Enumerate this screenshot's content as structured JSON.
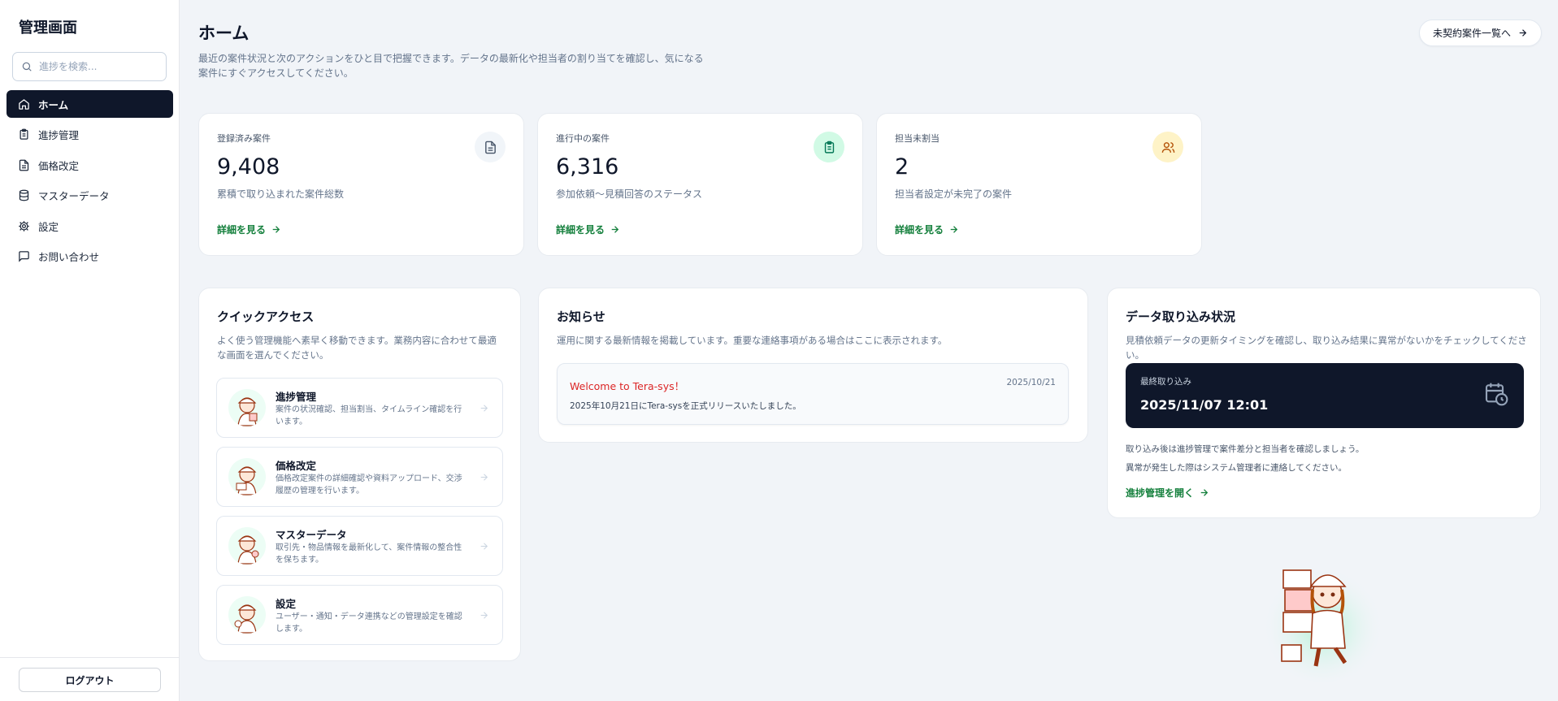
{
  "sidebar": {
    "brand": "管理画面",
    "search_placeholder": "進捗を検索...",
    "items": [
      {
        "label": "ホーム",
        "icon": "home-icon",
        "active": true
      },
      {
        "label": "進捗管理",
        "icon": "clipboard-icon"
      },
      {
        "label": "価格改定",
        "icon": "document-icon"
      },
      {
        "label": "マスターデータ",
        "icon": "database-icon"
      },
      {
        "label": "設定",
        "icon": "gear-icon"
      },
      {
        "label": "お問い合わせ",
        "icon": "message-icon"
      }
    ],
    "logout_label": "ログアウト"
  },
  "header": {
    "title": "ホーム",
    "description": "最近の案件状況と次のアクションをひと目で把握できます。データの最新化や担当者の割り当てを確認し、気になる案件にすぐアクセスしてください。",
    "top_button": "未契約案件一覧へ"
  },
  "stats": [
    {
      "label": "登録済み案件",
      "value": "9,408",
      "sub": "累積で取り込まれた案件総数",
      "link": "詳細を見る",
      "icon": "document-icon",
      "icon_bg": "#f1f5f9",
      "icon_color": "#475569"
    },
    {
      "label": "進行中の案件",
      "value": "6,316",
      "sub": "参加依頼〜見積回答のステータス",
      "link": "詳細を見る",
      "icon": "clipboard-icon",
      "icon_bg": "#d1fae5",
      "icon_color": "#047857"
    },
    {
      "label": "担当未割当",
      "value": "2",
      "sub": "担当者設定が未完了の案件",
      "link": "詳細を見る",
      "icon": "users-icon",
      "icon_bg": "#fef3c7",
      "icon_color": "#b45309"
    }
  ],
  "quick_access": {
    "title": "クイックアクセス",
    "description": "よく使う管理機能へ素早く移動できます。業務内容に合わせて最適な画面を選んでください。",
    "items": [
      {
        "title": "進捗管理",
        "desc": "案件の状況確認、担当割当、タイムライン確認を行います。"
      },
      {
        "title": "価格改定",
        "desc": "価格改定案件の詳細確認や資料アップロード、交渉履歴の管理を行います。"
      },
      {
        "title": "マスターデータ",
        "desc": "取引先・物品情報を最新化して、案件情報の整合性を保ちます。"
      },
      {
        "title": "設定",
        "desc": "ユーザー・通知・データ連携などの管理設定を確認します。"
      }
    ]
  },
  "notices": {
    "title": "お知らせ",
    "description": "運用に関する最新情報を掲載しています。重要な連絡事項がある場合はここに表示されます。",
    "items": [
      {
        "title": "Welcome to Tera-sys！",
        "date": "2025/10/21",
        "body": "2025年10月21日にTera-sysを正式リリースいたしました。"
      }
    ]
  },
  "import_status": {
    "title": "データ取り込み状況",
    "description": "見積依頼データの更新タイミングを確認し、取り込み結果に異常がないかをチェックしてください。",
    "last_label": "最終取り込み",
    "last_value": "2025/11/07 12:01",
    "note1": "取り込み後は進捗管理で案件差分と担当者を確認しましょう。",
    "note2": "異常が発生した際はシステム管理者に連絡してください。",
    "link": "進捗管理を開く"
  },
  "colors": {
    "accent": "#15803d",
    "dark": "#0f172a",
    "notice_title": "#dc2626"
  }
}
